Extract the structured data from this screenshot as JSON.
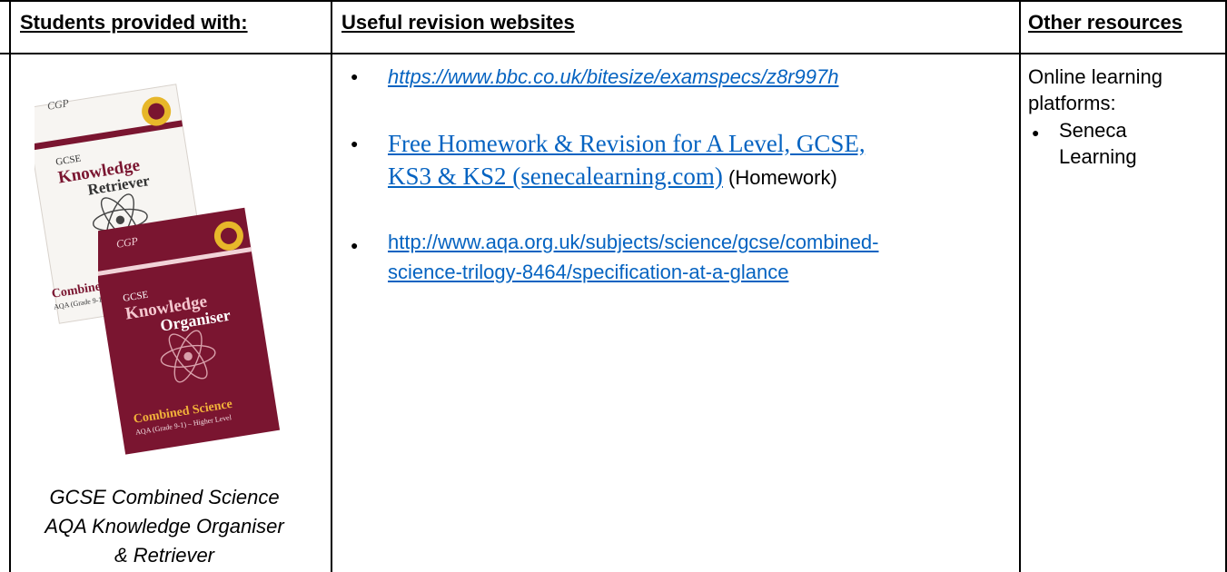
{
  "headers": {
    "col1": "Students provided with:",
    "col2": "Useful revision websites",
    "col3": "Other resources"
  },
  "col1": {
    "books": {
      "front": {
        "publisher": "CGP",
        "line1": "GCSE",
        "line2": "Knowledge",
        "line3": "Organiser",
        "subject": "Combined Science",
        "spec": "AQA (Grade 9-1) – Higher Level"
      },
      "back": {
        "publisher": "CGP",
        "line1": "GCSE",
        "line2": "Knowledge",
        "line3": "Retriever",
        "subject": "Combined Sc",
        "spec": "AQA (Grade 9-1) – Hig"
      }
    },
    "caption": {
      "line1": "GCSE Combined Science",
      "line2": "AQA Knowledge Organiser",
      "line3": "& Retriever"
    }
  },
  "col2": {
    "links": [
      {
        "text": "https://www.bbc.co.uk/bitesize/examspecs/z8r997h"
      },
      {
        "line1": "Free Homework & Revision for A Level, GCSE,",
        "line2": "KS3 & KS2 (senecalearning.com)",
        "suffix": "(Homework)"
      },
      {
        "line1": "http://www.aqa.org.uk/subjects/science/gcse/combined-",
        "line2": "science-trilogy-8464/specification-at-a-glance"
      }
    ]
  },
  "col3": {
    "intro1": "Online learning",
    "intro2": "platforms:",
    "bullet_line1": "Seneca",
    "bullet_line2": "Learning"
  },
  "colors": {
    "link": "#0563c1",
    "book_maroon": "#7a1530",
    "border": "#000000"
  }
}
